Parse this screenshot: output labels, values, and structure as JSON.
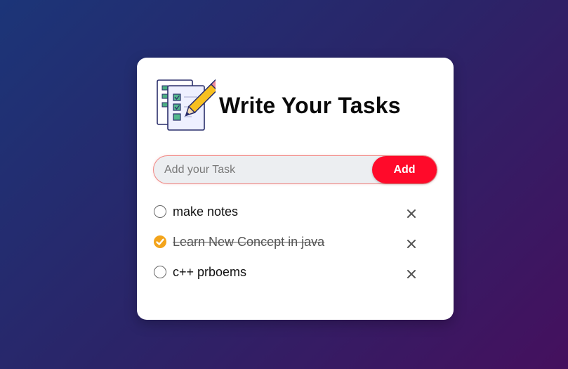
{
  "app": {
    "title": "Write Your Tasks",
    "header_icon": "checklist-pencil-icon"
  },
  "input": {
    "placeholder": "Add your Task",
    "value": "",
    "add_label": "Add"
  },
  "tasks": [
    {
      "text": "make notes",
      "completed": false
    },
    {
      "text": "Learn New Concept in java",
      "completed": true
    },
    {
      "text": "c++ prboems",
      "completed": false
    }
  ],
  "icons": {
    "unchecked": "unchecked-circle-icon",
    "checked": "checked-circle-icon",
    "delete": "close-icon"
  },
  "colors": {
    "accent": "#ff0a2a",
    "checked": "#f3a41b",
    "background_start": "#1c3578",
    "background_end": "#45105e"
  }
}
